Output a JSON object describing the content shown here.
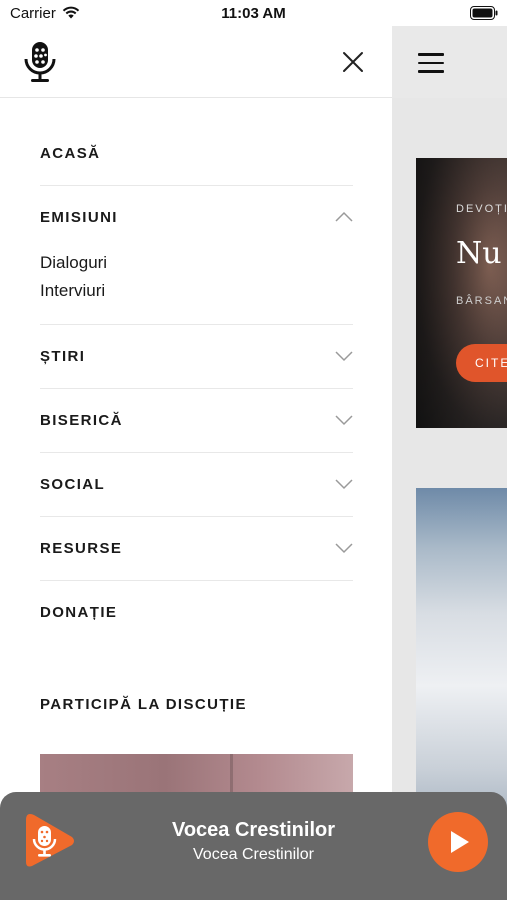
{
  "status_bar": {
    "carrier": "Carrier",
    "time": "11:03 AM"
  },
  "drawer": {
    "menu": [
      {
        "label": "ACASĂ"
      },
      {
        "label": "EMISIUNI",
        "expanded": true,
        "children": [
          "Dialoguri",
          "Interviuri"
        ]
      },
      {
        "label": "ȘTIRI"
      },
      {
        "label": "BISERICĂ"
      },
      {
        "label": "SOCIAL"
      },
      {
        "label": "RESURSE"
      },
      {
        "label": "DONAȚIE"
      }
    ],
    "participa_heading": "PARTICIPĂ LA DISCUȚIE"
  },
  "background_card": {
    "tag": "DEVOȚI",
    "title": "Nu",
    "author": "BÂRSAN",
    "button": "CITE"
  },
  "player": {
    "title": "Vocea Crestinilor",
    "subtitle": "Vocea Crestinilor"
  },
  "colors": {
    "accent": "#f06a2b",
    "player_bg": "#686868"
  }
}
